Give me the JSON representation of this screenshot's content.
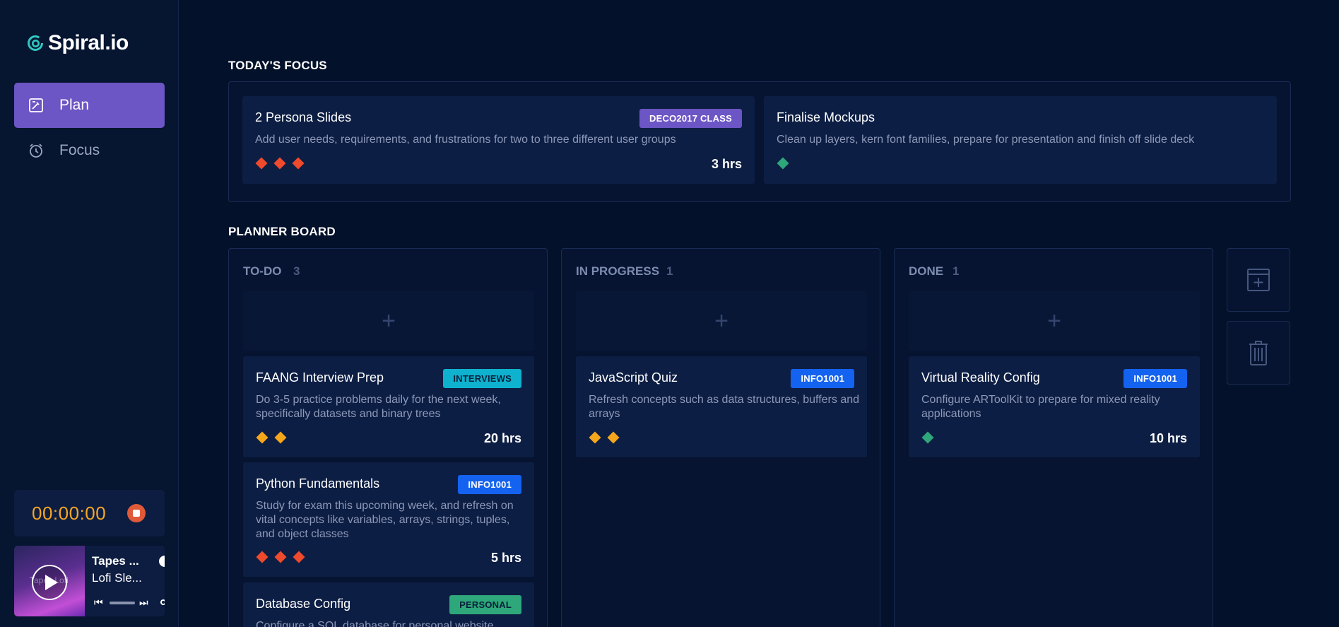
{
  "app": {
    "name": "Spiral.io"
  },
  "nav": [
    {
      "label": "Plan",
      "icon": "plan-icon",
      "active": true
    },
    {
      "label": "Focus",
      "icon": "stopwatch-icon",
      "active": false
    }
  ],
  "timer": {
    "time": "00:00:00"
  },
  "player": {
    "album_text": "Tapes Lofi",
    "title": "Tapes ...",
    "artist": "Lofi Sle..."
  },
  "focus": {
    "title": "TODAY'S FOCUS",
    "cards": [
      {
        "title": "2 Persona Slides",
        "badge": "DECO2017 CLASS",
        "description": "Add user needs, requirements, and frustrations for two to three different user groups",
        "priority": "high",
        "hours": "3 hrs"
      },
      {
        "title": "Finalise Mockups",
        "badge": "",
        "description": "Clean up layers, kern font families, prepare for presentation and finish off slide deck",
        "priority": "low",
        "hours": ""
      }
    ]
  },
  "board": {
    "title": "PLANNER BOARD",
    "columns": [
      {
        "name": "TO-DO",
        "count": "3",
        "tasks": [
          {
            "title": "FAANG Interview Prep",
            "badge": "INTERVIEWS",
            "description": "Do 3-5 practice problems daily for the next week, specifically datasets and binary trees",
            "priority": "medium",
            "hours": "20 hrs"
          },
          {
            "title": "Python Fundamentals",
            "badge": "INFO1001",
            "description": "Study for exam this upcoming week, and refresh on vital concepts like variables, arrays, strings, tuples, and object classes",
            "priority": "high",
            "hours": "5 hrs"
          },
          {
            "title": "Database Config",
            "badge": "PERSONAL",
            "description": "Configure a SQL database for personal website",
            "priority": "",
            "hours": ""
          }
        ]
      },
      {
        "name": "IN PROGRESS",
        "count": "1",
        "tasks": [
          {
            "title": "JavaScript Quiz",
            "badge": "INFO1001",
            "description": "Refresh concepts such as data structures, buffers and arrays",
            "priority": "medium",
            "hours": ""
          }
        ]
      },
      {
        "name": "DONE",
        "count": "1",
        "tasks": [
          {
            "title": "Virtual Reality Config",
            "badge": "INFO1001",
            "description": "Configure ARToolKit to prepare for mixed reality applications",
            "priority": "low",
            "hours": "10 hrs"
          }
        ]
      }
    ]
  },
  "colors": {
    "background": "#04112a",
    "accent": "#6c55c4",
    "timer": "#f5a623",
    "priority_high": "#f04a2c",
    "priority_medium": "#f5a71c",
    "priority_low": "#2ea77a"
  }
}
